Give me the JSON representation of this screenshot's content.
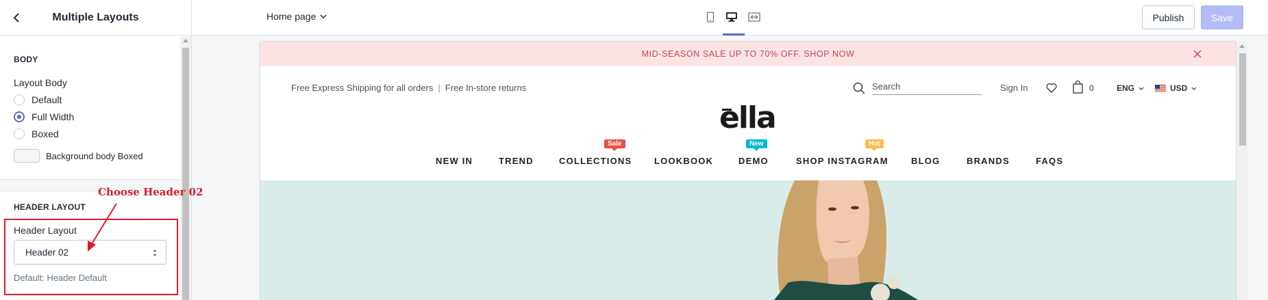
{
  "sidebar": {
    "title": "Multiple Layouts",
    "body_section": {
      "heading": "BODY",
      "layout_label": "Layout Body",
      "options": [
        {
          "label": "Default",
          "checked": false
        },
        {
          "label": "Full Width",
          "checked": true
        },
        {
          "label": "Boxed",
          "checked": false
        }
      ],
      "bg_label": "Background body Boxed"
    },
    "header_section": {
      "heading": "HEADER LAYOUT",
      "layout_label": "Header Layout",
      "selected": "Header 02",
      "help": "Default: Header Default"
    },
    "annotation": "Choose Header 02"
  },
  "topbar": {
    "page": "Home page",
    "devices": [
      "mobile-icon",
      "desktop-icon",
      "fullscreen-icon"
    ],
    "publish": "Publish",
    "save": "Save"
  },
  "preview": {
    "announcement": "MID-SEASON SALE UP TO 70% OFF. SHOP NOW",
    "shipping": "Free Express Shipping for all orders",
    "returns": "Free In-store returns",
    "search_placeholder": "Search",
    "sign_in": "Sign In",
    "cart_count": "0",
    "language": "ENG",
    "currency": "USD",
    "logo": "ella",
    "nav": [
      {
        "label": "NEW IN"
      },
      {
        "label": "TREND"
      },
      {
        "label": "COLLECTIONS",
        "badge": "Sale"
      },
      {
        "label": "LOOKBOOK"
      },
      {
        "label": "DEMO",
        "badge": "New"
      },
      {
        "label": "SHOP INSTAGRAM",
        "badge": "Hot"
      },
      {
        "label": "BLOG"
      },
      {
        "label": "BRANDS"
      },
      {
        "label": "FAQS"
      }
    ]
  },
  "colors": {
    "accent": "#5c6ac4",
    "annotation": "#d51c2d",
    "announcement_bg": "#fce4e4",
    "hero_bg": "#d9ecea",
    "badge_sale": "#e95144",
    "badge_new": "#01bad4",
    "badge_hot": "#ffbb49"
  }
}
